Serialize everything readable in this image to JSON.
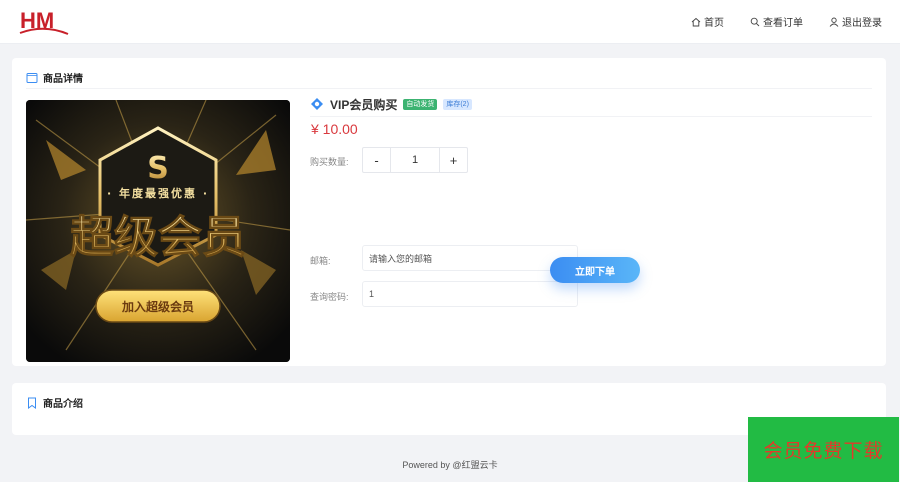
{
  "header": {
    "logo_text": "HM",
    "nav": [
      {
        "label": "首页",
        "icon": "home-icon"
      },
      {
        "label": "查看订单",
        "icon": "search-icon"
      },
      {
        "label": "退出登录",
        "icon": "user-icon"
      }
    ]
  },
  "detail": {
    "section_title": "商品详情",
    "image": {
      "tagline": "· 年度最强优惠 ·",
      "headline": "超级会员",
      "button_text": "加入超级会员",
      "emblem": "S"
    },
    "product_title": "VIP会员购买",
    "badge_auto": "自动发货",
    "badge_stock": "库存(2)",
    "price": "¥ 10.00",
    "qty_label": "购买数量:",
    "qty_minus": "-",
    "qty_value": "1",
    "qty_plus": "+",
    "email_label": "邮箱:",
    "email_placeholder": "请输入您的邮箱",
    "password_label": "查询密码:",
    "password_value": "1",
    "order_button": "立即下单"
  },
  "intro": {
    "section_title": "商品介绍"
  },
  "footer": {
    "text": "Powered by @红盟云卡"
  },
  "promo": {
    "text": "会员免费下载"
  },
  "colors": {
    "price": "#d9393e",
    "accent_blue": "#3b8df2",
    "promo_bg": "#22bb44",
    "promo_text": "#e23a2a"
  }
}
